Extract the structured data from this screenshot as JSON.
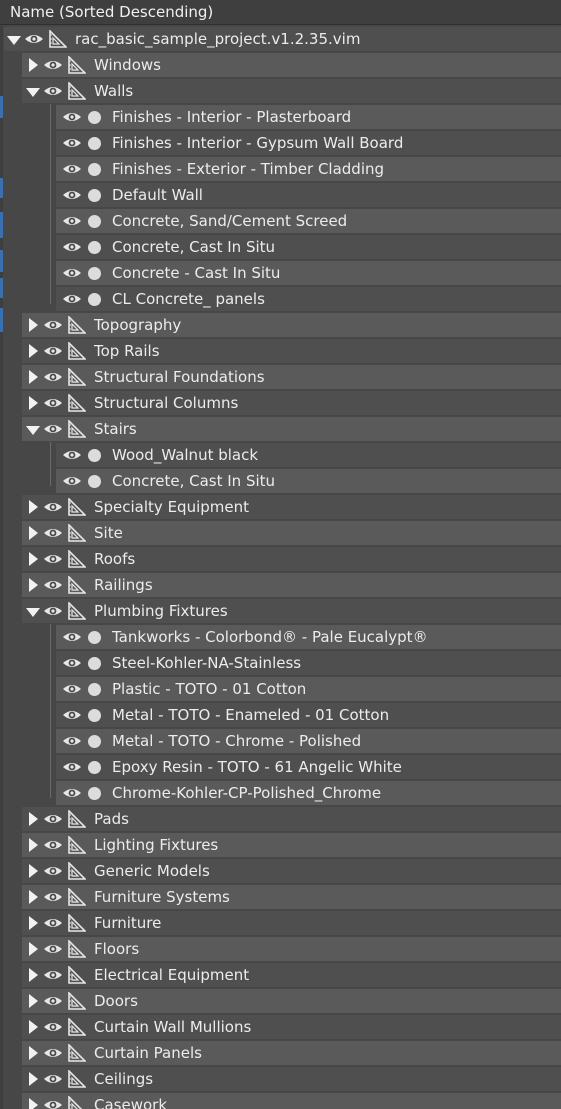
{
  "header": {
    "title": "Name (Sorted Descending)"
  },
  "tree": {
    "root": {
      "label": "rac_basic_sample_project.v1.2.35.vim"
    },
    "categories": [
      {
        "label": "Windows",
        "expanded": false,
        "materials": []
      },
      {
        "label": "Walls",
        "expanded": true,
        "materials": [
          "Finishes - Interior - Plasterboard",
          "Finishes - Interior - Gypsum Wall Board",
          "Finishes - Exterior - Timber Cladding",
          "Default Wall",
          "Concrete, Sand/Cement Screed",
          "Concrete, Cast In Situ",
          "Concrete - Cast In Situ",
          "CL Concrete_ panels"
        ]
      },
      {
        "label": "Topography",
        "expanded": false,
        "materials": []
      },
      {
        "label": "Top Rails",
        "expanded": false,
        "materials": []
      },
      {
        "label": "Structural Foundations",
        "expanded": false,
        "materials": []
      },
      {
        "label": "Structural Columns",
        "expanded": false,
        "materials": []
      },
      {
        "label": "Stairs",
        "expanded": true,
        "materials": [
          "Wood_Walnut black",
          "Concrete, Cast In Situ"
        ]
      },
      {
        "label": "Specialty Equipment",
        "expanded": false,
        "materials": []
      },
      {
        "label": "Site",
        "expanded": false,
        "materials": []
      },
      {
        "label": "Roofs",
        "expanded": false,
        "materials": []
      },
      {
        "label": "Railings",
        "expanded": false,
        "materials": []
      },
      {
        "label": "Plumbing Fixtures",
        "expanded": true,
        "materials": [
          "Tankworks - Colorbond® - Pale Eucalypt®",
          "Steel-Kohler-NA-Stainless",
          "Plastic - TOTO - 01 Cotton",
          "Metal - TOTO - Enameled - 01 Cotton",
          "Metal - TOTO - Chrome - Polished",
          "Epoxy Resin - TOTO - 61 Angelic White",
          "Chrome-Kohler-CP-Polished_Chrome"
        ]
      },
      {
        "label": "Pads",
        "expanded": false,
        "materials": []
      },
      {
        "label": "Lighting Fixtures",
        "expanded": false,
        "materials": []
      },
      {
        "label": "Generic Models",
        "expanded": false,
        "materials": []
      },
      {
        "label": "Furniture Systems",
        "expanded": false,
        "materials": []
      },
      {
        "label": "Furniture",
        "expanded": false,
        "materials": []
      },
      {
        "label": "Floors",
        "expanded": false,
        "materials": []
      },
      {
        "label": "Electrical Equipment",
        "expanded": false,
        "materials": []
      },
      {
        "label": "Doors",
        "expanded": false,
        "materials": []
      },
      {
        "label": "Curtain Wall Mullions",
        "expanded": false,
        "materials": []
      },
      {
        "label": "Curtain Panels",
        "expanded": false,
        "materials": []
      },
      {
        "label": "Ceilings",
        "expanded": false,
        "materials": []
      },
      {
        "label": "Casework",
        "expanded": false,
        "materials": []
      }
    ]
  },
  "icons": {
    "expander_collapsed": "triangle-right-icon",
    "expander_expanded": "triangle-down-icon",
    "visibility": "eye-icon",
    "element": "set-square-icon",
    "material": "material-dot-icon"
  },
  "colors": {
    "panel_bg": "#474747",
    "row_even": "#4f4f4f",
    "row_odd": "#5a5a5a",
    "text": "#ececec",
    "selection_accent": "#3a6fb0"
  }
}
